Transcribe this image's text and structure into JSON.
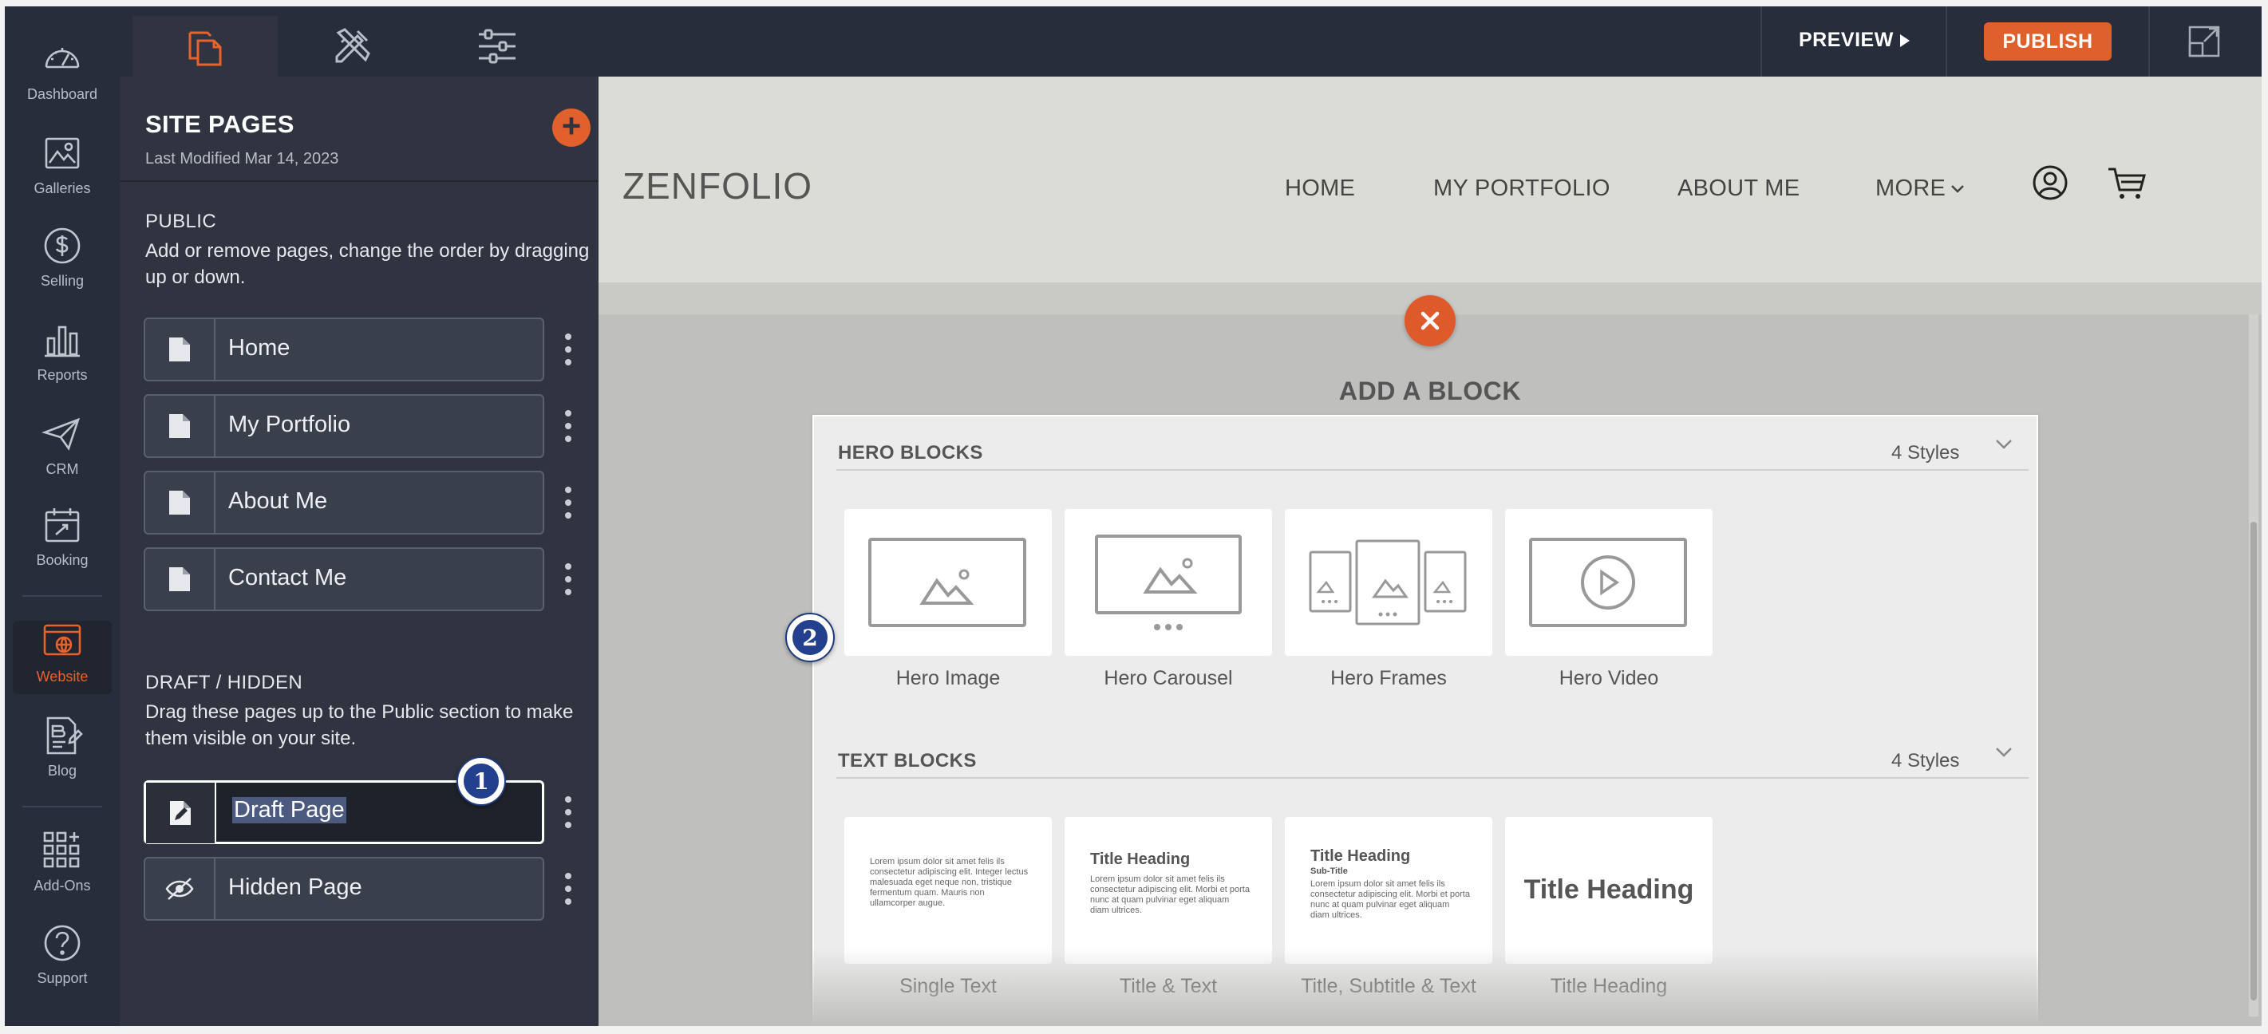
{
  "rail": {
    "items": [
      {
        "label": "Dashboard",
        "icon": "speedometer-icon"
      },
      {
        "label": "Galleries",
        "icon": "image-icon"
      },
      {
        "label": "Selling",
        "icon": "dollar-icon"
      },
      {
        "label": "Reports",
        "icon": "bar-chart-icon"
      },
      {
        "label": "CRM",
        "icon": "paper-plane-icon"
      },
      {
        "label": "Booking",
        "icon": "calendar-icon"
      },
      {
        "label": "Website",
        "icon": "website-icon",
        "active": true
      },
      {
        "label": "Blog",
        "icon": "blog-icon"
      },
      {
        "label": "Add-Ons",
        "icon": "grid-plus-icon"
      },
      {
        "label": "Support",
        "icon": "question-icon"
      }
    ],
    "active_color": "#e8622c"
  },
  "panel": {
    "tabs": [
      {
        "icon": "pages-icon",
        "active": true
      },
      {
        "icon": "design-tools-icon"
      },
      {
        "icon": "settings-sliders-icon"
      }
    ],
    "title": "SITE PAGES",
    "last_modified": "Last Modified Mar 14, 2023",
    "public_title": "PUBLIC",
    "public_desc": "Add or remove pages, change the order by dragging up or down.",
    "public_pages": [
      "Home",
      "My Portfolio",
      "About Me",
      "Contact Me"
    ],
    "draft_title": "DRAFT / HIDDEN",
    "draft_desc": "Drag these pages up to the Public section to make them visible on your site.",
    "draft_pages": [
      {
        "label": "Draft Page",
        "icon": "draft-edit-icon",
        "selected": true
      },
      {
        "label": "Hidden Page",
        "icon": "eye-slash-icon"
      }
    ]
  },
  "annotations": {
    "step1": "1",
    "step2": "2"
  },
  "topbar": {
    "preview": "PREVIEW",
    "publish": "PUBLISH",
    "publish_color": "#e0602b"
  },
  "site": {
    "logo": "ZENFOLIO",
    "nav": [
      "HOME",
      "MY PORTFOLIO",
      "ABOUT ME",
      "MORE"
    ]
  },
  "add_block": {
    "title": "ADD A BLOCK",
    "categories": [
      {
        "title": "HERO BLOCKS",
        "count": "4 Styles",
        "tiles": [
          "Hero Image",
          "Hero Carousel",
          "Hero Frames",
          "Hero Video"
        ]
      },
      {
        "title": "TEXT BLOCKS",
        "count": "4 Styles",
        "tiles": [
          "Single Text",
          "Title & Text",
          "Title, Subtitle & Text",
          "Title Heading"
        ]
      }
    ],
    "previews": {
      "lorem1": "Lorem ipsum dolor sit amet felis ils consectetur adipiscing elit. Integer lectus malesuada eget neque non, tristique fermentum quam. Mauris non ullamcorper augue.",
      "lorem2": "Lorem ipsum dolor sit amet felis ils consectetur adipiscing elit. Morbi et porta nunc at quam pulvinar eget aliquam diam ultrices.",
      "title_heading": "Title Heading",
      "sub_title": "Sub-Title"
    }
  }
}
